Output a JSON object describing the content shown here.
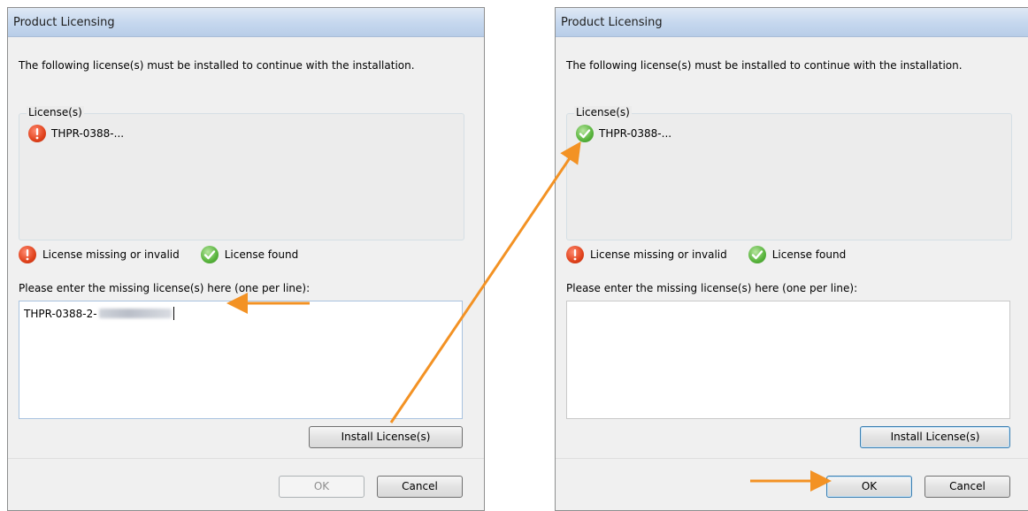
{
  "left_dialog": {
    "title": "Product Licensing",
    "message": "The following license(s) must be installed to continue with the installation.",
    "group_label": "License(s)",
    "license_item": "THPR-0388-...",
    "legend": {
      "missing": "License missing or invalid",
      "found": "License found"
    },
    "prompt": "Please enter the missing license(s) here (one per line):",
    "input_value": "THPR-0388-2-",
    "install_button": "Install License(s)",
    "ok_button": "OK",
    "cancel_button": "Cancel"
  },
  "right_dialog": {
    "title": "Product Licensing",
    "message": "The following license(s) must be installed to continue with the installation.",
    "group_label": "License(s)",
    "license_item": "THPR-0388-...",
    "legend": {
      "missing": "License missing or invalid",
      "found": "License found"
    },
    "prompt": "Please enter the missing license(s) here (one per line):",
    "input_value": "",
    "install_button": "Install License(s)",
    "ok_button": "OK",
    "cancel_button": "Cancel"
  },
  "colors": {
    "arrow": "#f39224",
    "error_icon": "#e0421c",
    "ok_icon": "#57b33b"
  }
}
